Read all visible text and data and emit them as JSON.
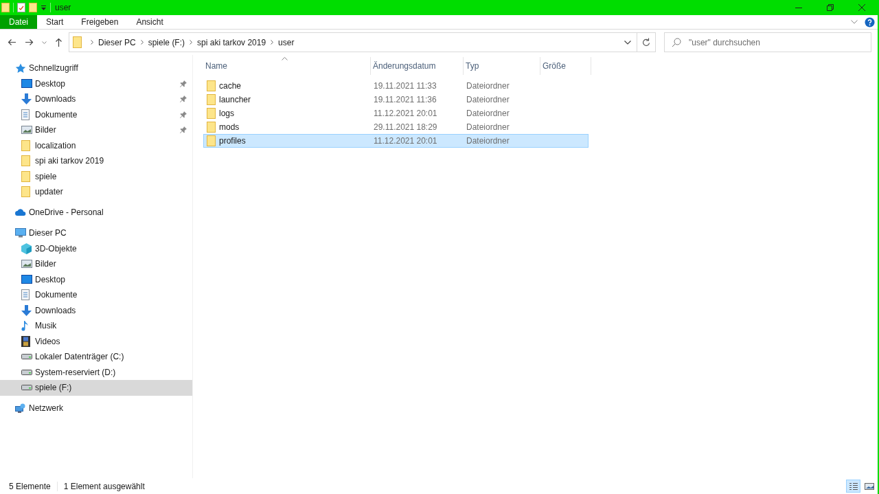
{
  "window": {
    "title": "user"
  },
  "ribbon_tabs": [
    {
      "label": "Datei",
      "kind": "file",
      "selected": false
    },
    {
      "label": "Start",
      "kind": "tab",
      "selected": false
    },
    {
      "label": "Freigeben",
      "kind": "tab",
      "selected": false
    },
    {
      "label": "Ansicht",
      "kind": "tab",
      "selected": false
    }
  ],
  "address_bar": {
    "breadcrumbs": [
      "Dieser PC",
      "spiele (F:)",
      "spi aki tarkov 2019",
      "user"
    ]
  },
  "search": {
    "placeholder": "\"user\" durchsuchen"
  },
  "sidebar": {
    "items": [
      {
        "label": "Schnellzugriff",
        "kind": "star",
        "selected": false,
        "children": [
          {
            "label": "Desktop",
            "kind": "desktop",
            "pinned": true,
            "selected": false
          },
          {
            "label": "Downloads",
            "kind": "download",
            "pinned": true,
            "selected": false
          },
          {
            "label": "Dokumente",
            "kind": "document",
            "pinned": true,
            "selected": false
          },
          {
            "label": "Bilder",
            "kind": "pictures",
            "pinned": true,
            "selected": false
          },
          {
            "label": "localization",
            "kind": "folder",
            "pinned": false,
            "selected": false
          },
          {
            "label": "spi aki tarkov 2019",
            "kind": "folder",
            "pinned": false,
            "selected": false
          },
          {
            "label": "spiele",
            "kind": "folder",
            "pinned": false,
            "selected": false
          },
          {
            "label": "updater",
            "kind": "folder",
            "pinned": false,
            "selected": false
          }
        ]
      },
      {
        "label": "OneDrive - Personal",
        "kind": "cloud",
        "selected": false
      },
      {
        "label": "Dieser PC",
        "kind": "pc",
        "selected": false,
        "children": [
          {
            "label": "3D-Objekte",
            "kind": "cube",
            "selected": false
          },
          {
            "label": "Bilder",
            "kind": "pictures",
            "selected": false
          },
          {
            "label": "Desktop",
            "kind": "desktop",
            "selected": false
          },
          {
            "label": "Dokumente",
            "kind": "document",
            "selected": false
          },
          {
            "label": "Downloads",
            "kind": "download",
            "selected": false
          },
          {
            "label": "Musik",
            "kind": "music",
            "selected": false
          },
          {
            "label": "Videos",
            "kind": "video",
            "selected": false
          },
          {
            "label": "Lokaler Datenträger (C:)",
            "kind": "drive",
            "selected": false
          },
          {
            "label": "System-reserviert (D:)",
            "kind": "drive",
            "selected": false
          },
          {
            "label": "spiele (F:)",
            "kind": "drive",
            "selected": true
          }
        ]
      },
      {
        "label": "Netzwerk",
        "kind": "network",
        "selected": false
      }
    ]
  },
  "table": {
    "columns": [
      "Name",
      "Änderungsdatum",
      "Typ",
      "Größe"
    ],
    "rows": [
      {
        "name": "cache",
        "date": "19.11.2021 11:33",
        "type": "Dateiordner",
        "selected": false
      },
      {
        "name": "launcher",
        "date": "19.11.2021 11:36",
        "type": "Dateiordner",
        "selected": false
      },
      {
        "name": "logs",
        "date": "11.12.2021 20:01",
        "type": "Dateiordner",
        "selected": false
      },
      {
        "name": "mods",
        "date": "29.11.2021 18:29",
        "type": "Dateiordner",
        "selected": false
      },
      {
        "name": "profiles",
        "date": "11.12.2021 20:01",
        "type": "Dateiordner",
        "selected": true
      }
    ]
  },
  "status_bar": {
    "item_count": "5 Elemente",
    "selection": "1 Element ausgewählt",
    "views": [
      {
        "kind": "details",
        "selected": true
      },
      {
        "kind": "large-icons",
        "selected": false
      }
    ]
  }
}
